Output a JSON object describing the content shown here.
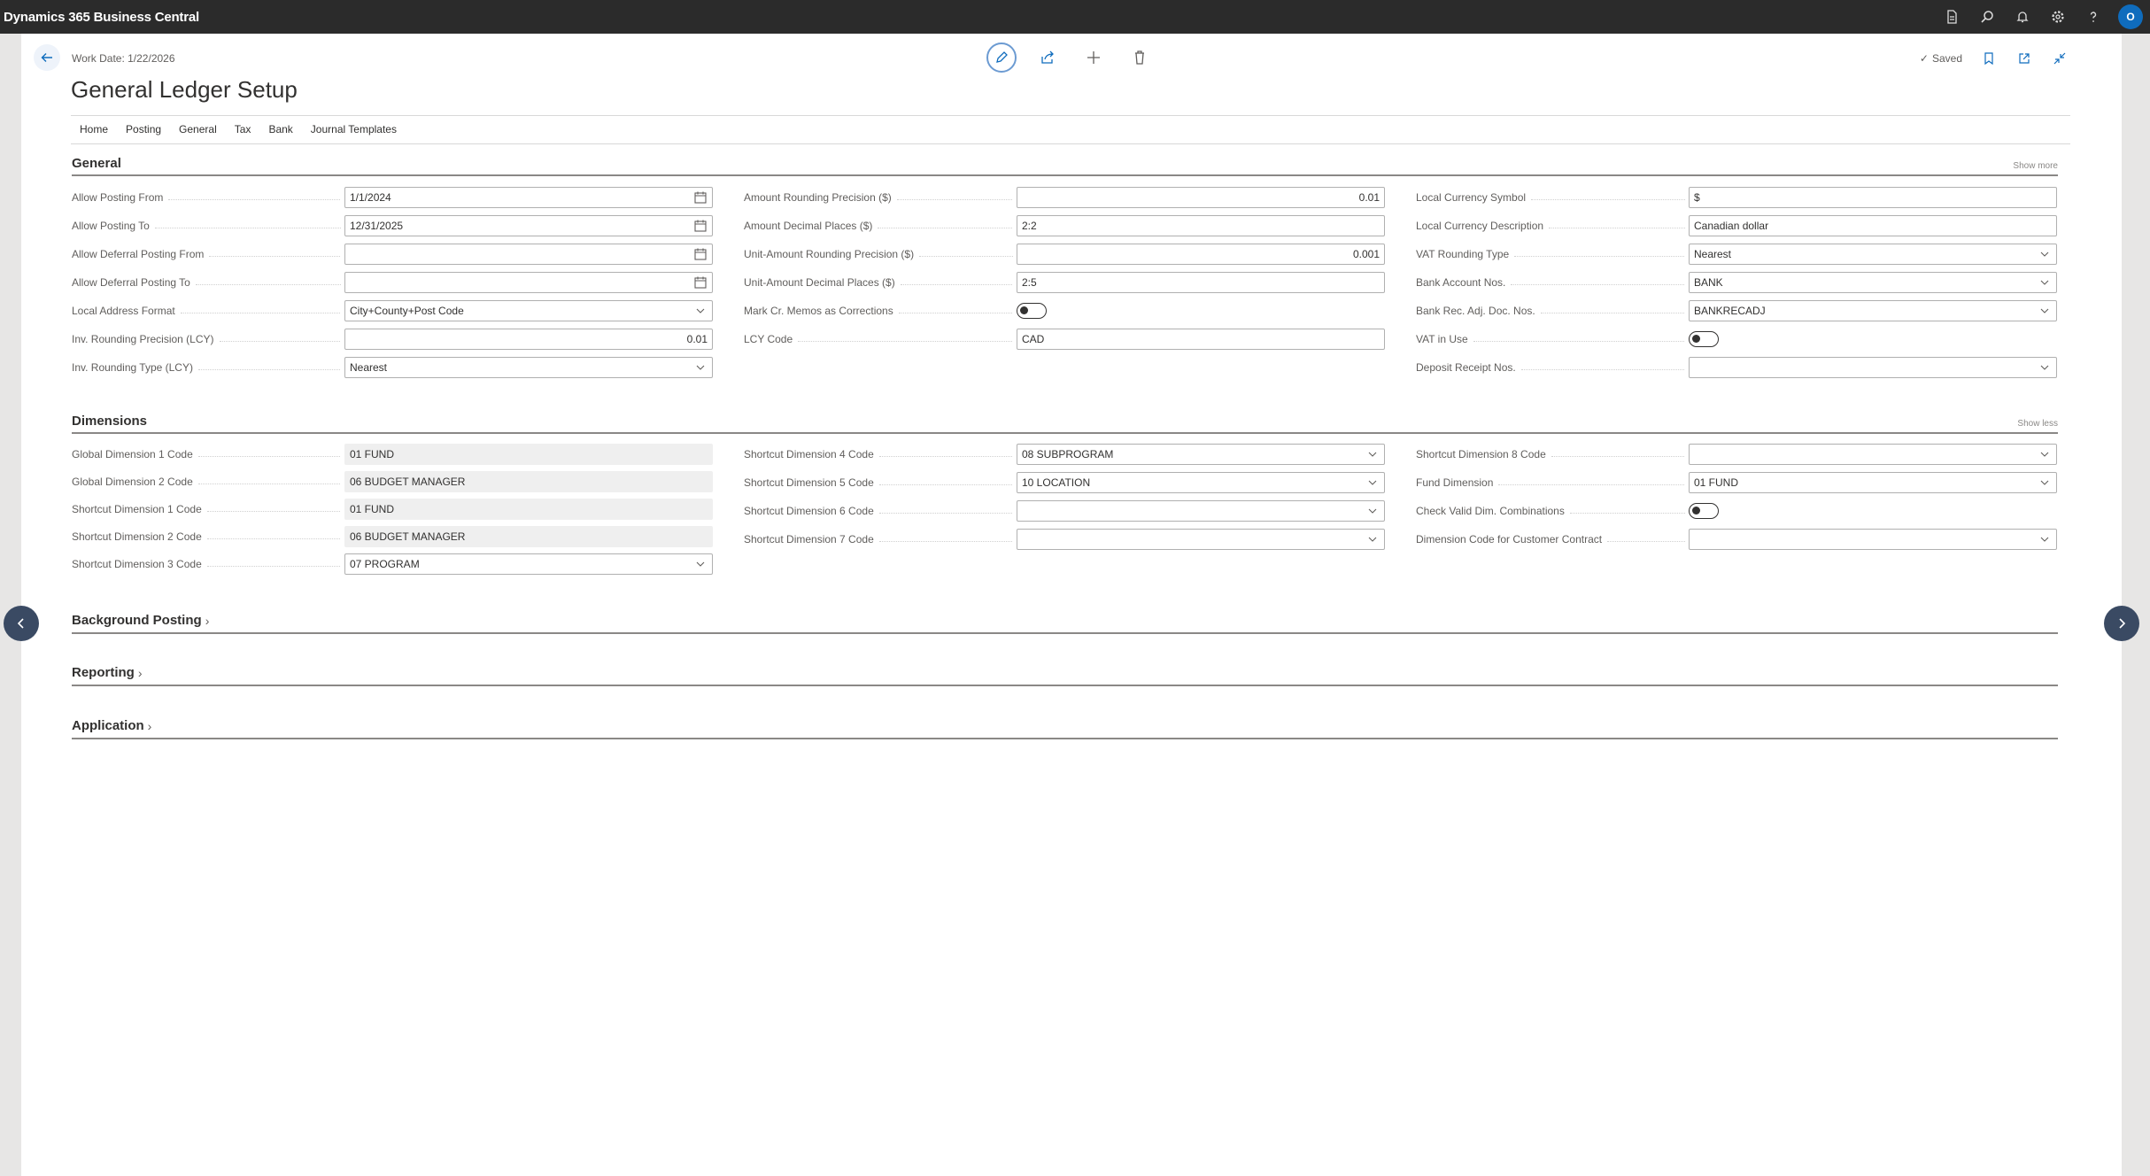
{
  "app": {
    "title": "Dynamics 365 Business Central",
    "avatar_initial": "O",
    "top_icons": [
      "document-icon",
      "search-icon",
      "bell-icon",
      "settings-icon",
      "help-icon"
    ]
  },
  "page": {
    "work_date": "Work Date: 1/22/2026",
    "title": "General Ledger Setup",
    "saved_label": "Saved"
  },
  "actions": [
    "Home",
    "Posting",
    "General",
    "Tax",
    "Bank",
    "Journal Templates"
  ],
  "general": {
    "title": "General",
    "link": "Show more",
    "col1": [
      {
        "label": "Allow Posting From",
        "value": "1/1/2024",
        "kind": "date"
      },
      {
        "label": "Allow Posting To",
        "value": "12/31/2025",
        "kind": "date"
      },
      {
        "label": "Allow Deferral Posting From",
        "value": "",
        "kind": "date"
      },
      {
        "label": "Allow Deferral Posting To",
        "value": "",
        "kind": "date"
      },
      {
        "label": "Local Address Format",
        "value": "City+County+Post Code",
        "kind": "select"
      },
      {
        "label": "Inv. Rounding Precision (LCY)",
        "value": "0.01",
        "kind": "number"
      },
      {
        "label": "Inv. Rounding Type (LCY)",
        "value": "Nearest",
        "kind": "select"
      }
    ],
    "col2": [
      {
        "label": "Amount Rounding Precision ($)",
        "value": "0.01",
        "kind": "number"
      },
      {
        "label": "Amount Decimal Places ($)",
        "value": "2:2",
        "kind": "text"
      },
      {
        "label": "Unit-Amount Rounding Precision ($)",
        "value": "0.001",
        "kind": "number"
      },
      {
        "label": "Unit-Amount Decimal Places ($)",
        "value": "2:5",
        "kind": "text"
      },
      {
        "label": "Mark Cr. Memos as Corrections",
        "value": "",
        "kind": "toggle"
      },
      {
        "label": "LCY Code",
        "value": "CAD",
        "kind": "text"
      }
    ],
    "col3": [
      {
        "label": "Local Currency Symbol",
        "value": "$",
        "kind": "text"
      },
      {
        "label": "Local Currency Description",
        "value": "Canadian dollar",
        "kind": "text"
      },
      {
        "label": "VAT Rounding Type",
        "value": "Nearest",
        "kind": "select"
      },
      {
        "label": "Bank Account Nos.",
        "value": "BANK",
        "kind": "select"
      },
      {
        "label": "Bank Rec. Adj. Doc. Nos.",
        "value": "BANKRECADJ",
        "kind": "select"
      },
      {
        "label": "VAT in Use",
        "value": "",
        "kind": "toggle"
      },
      {
        "label": "Deposit Receipt Nos.",
        "value": "",
        "kind": "select"
      }
    ]
  },
  "dimensions": {
    "title": "Dimensions",
    "link": "Show less",
    "col1": [
      {
        "label": "Global Dimension 1 Code",
        "value": "01 FUND",
        "kind": "readonly"
      },
      {
        "label": "Global Dimension 2 Code",
        "value": "06 BUDGET MANAGER",
        "kind": "readonly"
      },
      {
        "label": "Shortcut Dimension 1 Code",
        "value": "01 FUND",
        "kind": "readonly"
      },
      {
        "label": "Shortcut Dimension 2 Code",
        "value": "06 BUDGET MANAGER",
        "kind": "readonly"
      },
      {
        "label": "Shortcut Dimension 3 Code",
        "value": "07 PROGRAM",
        "kind": "select"
      }
    ],
    "col2": [
      {
        "label": "Shortcut Dimension 4 Code",
        "value": "08 SUBPROGRAM",
        "kind": "select"
      },
      {
        "label": "Shortcut Dimension 5 Code",
        "value": "10 LOCATION",
        "kind": "select"
      },
      {
        "label": "Shortcut Dimension 6 Code",
        "value": "",
        "kind": "select"
      },
      {
        "label": "Shortcut Dimension 7 Code",
        "value": "",
        "kind": "select"
      }
    ],
    "col3": [
      {
        "label": "Shortcut Dimension 8 Code",
        "value": "",
        "kind": "select"
      },
      {
        "label": "Fund Dimension",
        "value": "01 FUND",
        "kind": "select"
      },
      {
        "label": "Check Valid Dim. Combinations",
        "value": "",
        "kind": "toggle"
      },
      {
        "label": "Dimension Code for Customer Contract",
        "value": "",
        "kind": "select"
      }
    ]
  },
  "collapsed_sections": [
    "Background Posting",
    "Reporting",
    "Application"
  ]
}
